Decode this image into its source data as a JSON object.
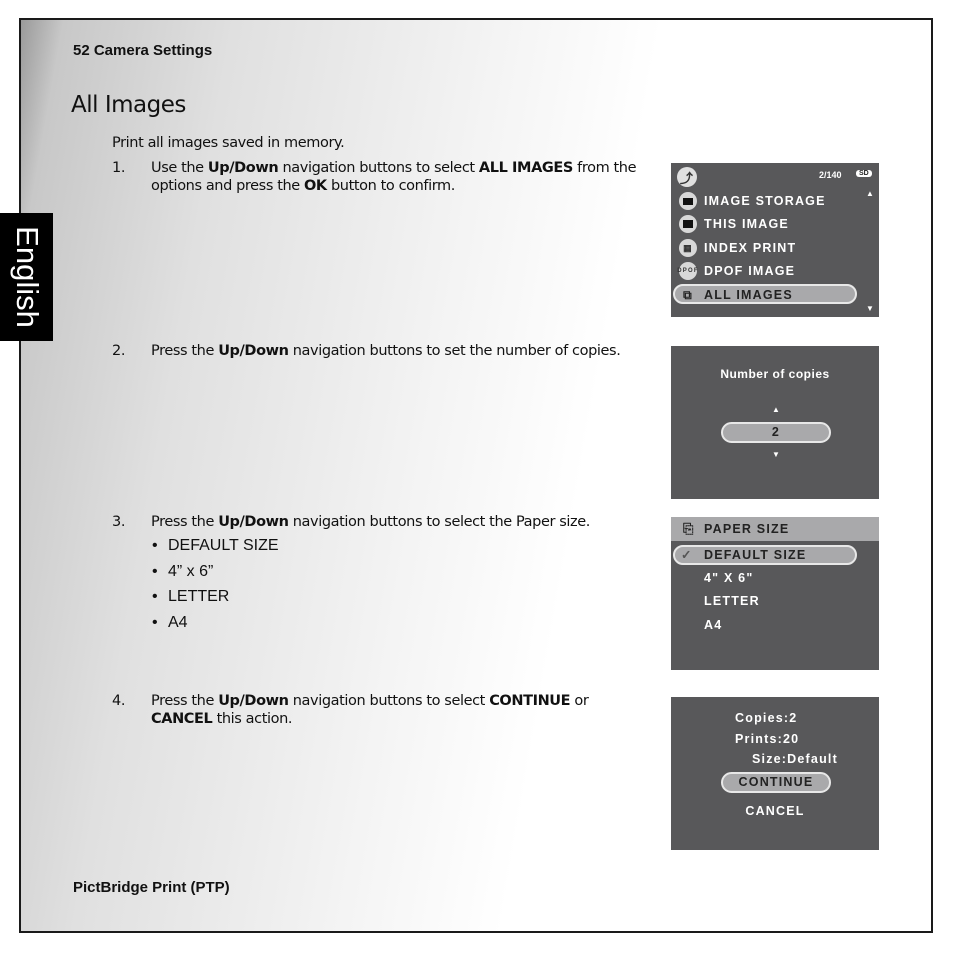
{
  "header": {
    "page_number": "52",
    "section": "Camera Settings",
    "label": "52  Camera Settings"
  },
  "side_tab": {
    "label": "English"
  },
  "title": "All Images",
  "intro": "Print all images saved in memory.",
  "steps": [
    {
      "num": "1.",
      "parts": [
        "Use the ",
        "Up/Down",
        " navigation buttons to select ",
        "ALL IMAGES",
        " from the options and press the ",
        "OK",
        " button to confirm."
      ]
    },
    {
      "num": "2.",
      "parts": [
        "Press the ",
        "Up/Down",
        " navigation buttons to set the number of copies."
      ]
    },
    {
      "num": "3.",
      "parts": [
        "Press the ",
        "Up/Down",
        " navigation buttons to select the Paper size."
      ]
    },
    {
      "num": "4.",
      "parts": [
        "Press the ",
        "Up/Down",
        " navigation buttons to select ",
        "CONTINUE",
        " or ",
        "CANCEL",
        " this action."
      ]
    }
  ],
  "paper_sizes": [
    "DEFAULT SIZE",
    "4” x 6”",
    "LETTER",
    "A4"
  ],
  "footer": "PictBridge Print (PTP)",
  "screens": {
    "menu": {
      "counter": "2/140",
      "card": "SD",
      "items": [
        {
          "label": "IMAGE STORAGE",
          "icon": "storage-icon"
        },
        {
          "label": "THIS IMAGE",
          "icon": "image-icon"
        },
        {
          "label": "INDEX PRINT",
          "icon": "index-grid-icon"
        },
        {
          "label": "DPOF IMAGE",
          "icon": "dpof-icon"
        },
        {
          "label": "ALL IMAGES",
          "icon": "all-images-icon",
          "selected": true
        }
      ]
    },
    "copies": {
      "title": "Number of copies",
      "value": "2"
    },
    "paper": {
      "title": "PAPER SIZE",
      "items": [
        {
          "label": "DEFAULT SIZE",
          "selected": true
        },
        {
          "label": "4\" X 6\""
        },
        {
          "label": "LETTER"
        },
        {
          "label": "A4"
        }
      ]
    },
    "confirm": {
      "copies": "Copies:2",
      "prints": "Prints:20",
      "size": "Size:Default",
      "continue": "CONTINUE",
      "cancel": "CANCEL"
    }
  },
  "colors": {
    "lcd_bg": "#58585a",
    "highlight": "#a9a9ab",
    "tab_bg": "#000000"
  }
}
